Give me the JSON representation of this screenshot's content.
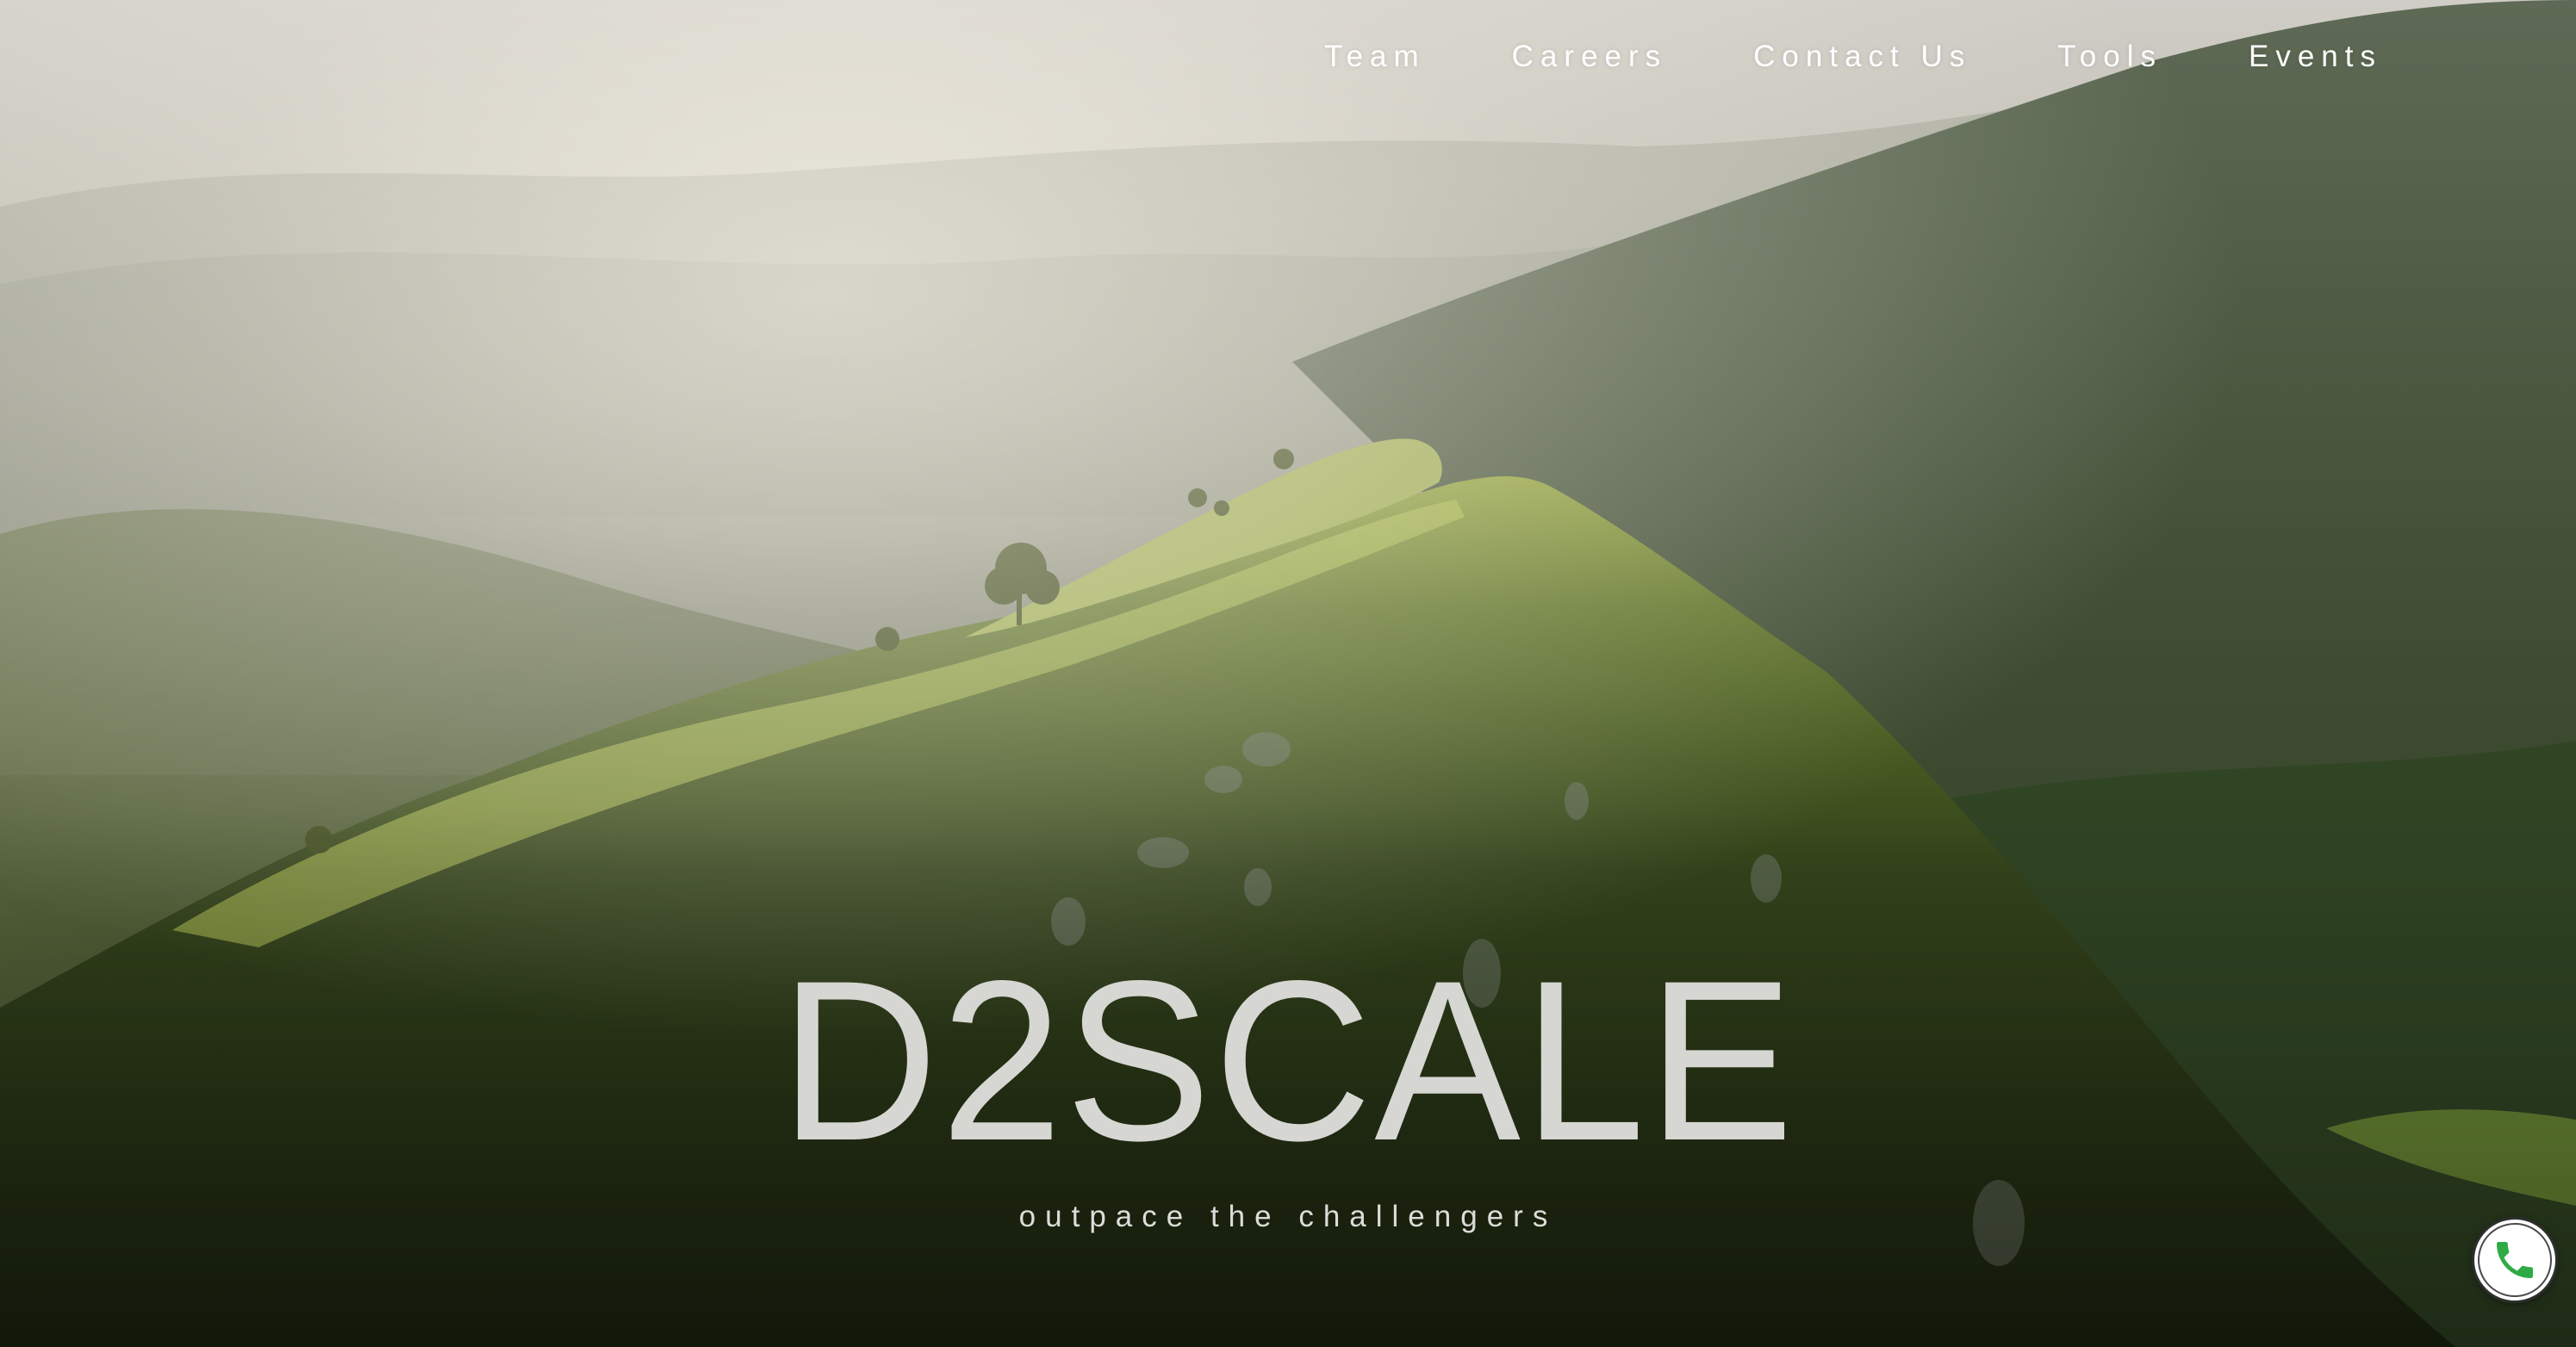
{
  "nav": {
    "items": [
      {
        "label": "Team"
      },
      {
        "label": "Careers"
      },
      {
        "label": "Contact Us"
      },
      {
        "label": "Tools"
      },
      {
        "label": "Events"
      }
    ]
  },
  "hero": {
    "title": "D2SCALE",
    "tagline": "outpace the challengers"
  },
  "call_button": {
    "icon": "phone-icon",
    "accent_color": "#2faa44"
  },
  "colors": {
    "nav_text": "#ffffff",
    "title_text": "#d6d6d2"
  }
}
